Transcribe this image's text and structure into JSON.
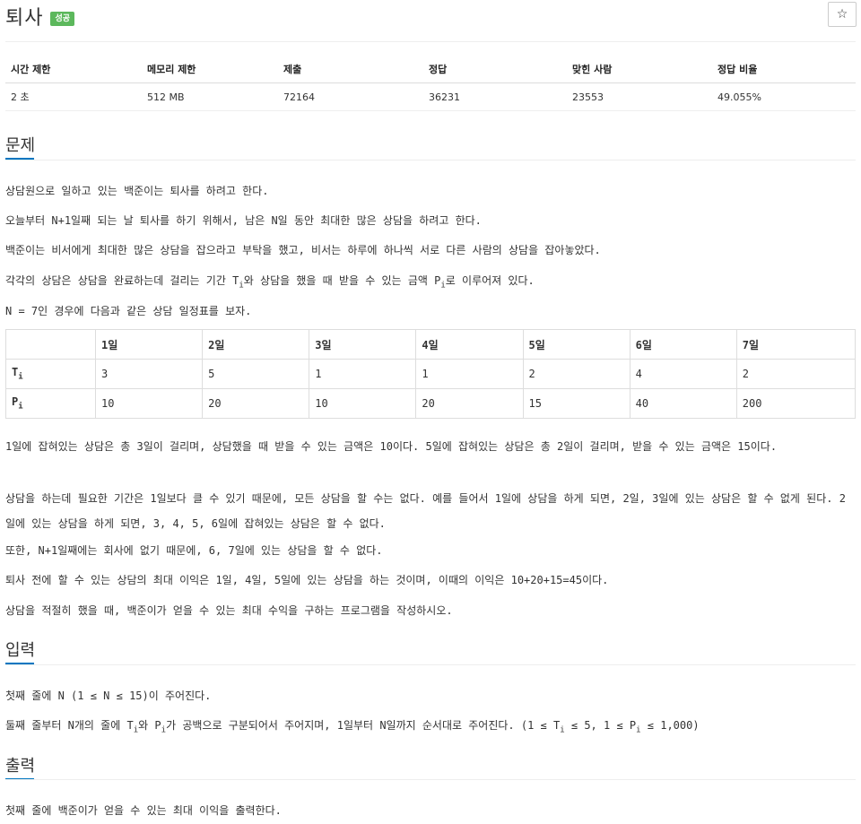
{
  "problem": {
    "title": "퇴사",
    "status_badge": "성공",
    "star_icon": "☆"
  },
  "stats": {
    "headers": [
      "시간 제한",
      "메모리 제한",
      "제출",
      "정답",
      "맞힌 사람",
      "정답 비율"
    ],
    "values": [
      "2 초",
      "512 MB",
      "72164",
      "36231",
      "23553",
      "49.055%"
    ]
  },
  "sections": {
    "problem": "문제",
    "input": "입력",
    "output": "출력"
  },
  "description": {
    "p1": "상담원으로 일하고 있는 백준이는 퇴사를 하려고 한다.",
    "p2": "오늘부터 N+1일째 되는 날 퇴사를 하기 위해서, 남은 N일 동안 최대한 많은 상담을 하려고 한다.",
    "p3": "백준이는 비서에게 최대한 많은 상담을 잡으라고 부탁을 했고, 비서는 하루에 하나씩 서로 다른 사람의 상담을 잡아놓았다.",
    "p4_a": "각각의 상담은 상담을 완료하는데 걸리는 기간 T",
    "p4_sub1": "i",
    "p4_b": "와 상담을 했을 때 받을 수 있는 금액 P",
    "p4_sub2": "i",
    "p4_c": "로 이루어져 있다.",
    "p5": "N = 7인 경우에 다음과 같은 상담 일정표를 보자.",
    "p6": "1일에 잡혀있는 상담은 총 3일이 걸리며, 상담했을 때 받을 수 있는 금액은 10이다. 5일에 잡혀있는 상담은 총 2일이 걸리며, 받을 수 있는 금액은 15이다.",
    "p7": "상담을 하는데 필요한 기간은 1일보다 클 수 있기 때문에, 모든 상담을 할 수는 없다. 예를 들어서 1일에 상담을 하게 되면, 2일, 3일에 있는 상담은 할 수 없게 된다. 2일에 있는 상담을 하게 되면, 3, 4, 5, 6일에 잡혀있는 상담은 할 수 없다.",
    "p8": "또한, N+1일째에는 회사에 없기 때문에, 6, 7일에 있는 상담을 할 수 없다.",
    "p9": "퇴사 전에 할 수 있는 상담의 최대 이익은 1일, 4일, 5일에 있는 상담을 하는 것이며, 이때의 이익은 10+20+15=45이다.",
    "p10": "상담을 적절히 했을 때, 백준이가 얻을 수 있는 최대 수익을 구하는 프로그램을 작성하시오."
  },
  "schedule": {
    "days": [
      "1일",
      "2일",
      "3일",
      "4일",
      "5일",
      "6일",
      "7일"
    ],
    "t_label": "T",
    "p_label": "P",
    "sub": "i",
    "t_values": [
      "3",
      "5",
      "1",
      "1",
      "2",
      "4",
      "2"
    ],
    "p_values": [
      "10",
      "20",
      "10",
      "20",
      "15",
      "40",
      "200"
    ]
  },
  "input": {
    "l1": "첫째 줄에 N (1 ≤ N ≤ 15)이 주어진다.",
    "l2_a": "둘째 줄부터 N개의 줄에 T",
    "l2_sub1": "i",
    "l2_b": "와 P",
    "l2_sub2": "i",
    "l2_c": "가 공백으로 구분되어서 주어지며, 1일부터 N일까지 순서대로 주어진다. (1 ≤ T",
    "l2_sub3": "i",
    "l2_d": " ≤ 5, 1 ≤ P",
    "l2_sub4": "i",
    "l2_e": " ≤ 1,000)"
  },
  "output": {
    "l1": "첫째 줄에 백준이가 얻을 수 있는 최대 이익을 출력한다."
  }
}
